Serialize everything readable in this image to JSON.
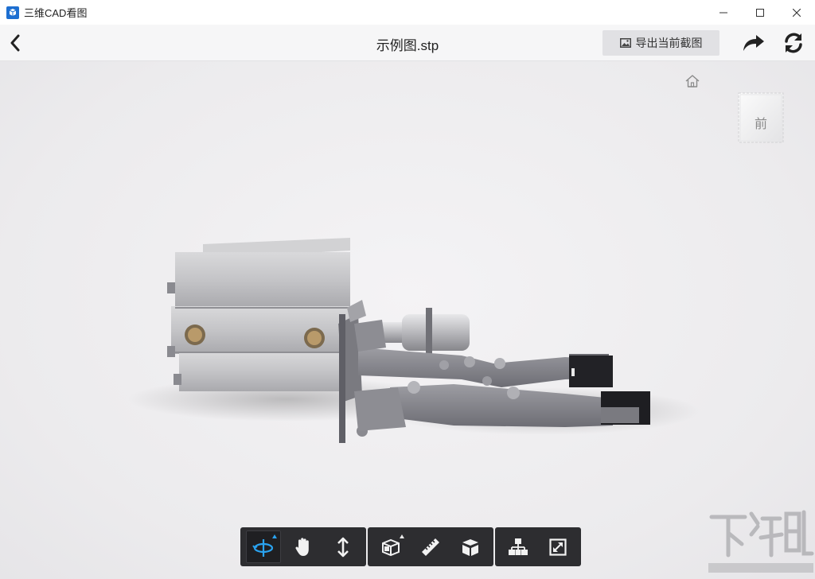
{
  "window": {
    "title": "三维CAD看图",
    "controls": [
      "minimize-icon",
      "maximize-icon",
      "close-icon"
    ]
  },
  "header": {
    "back_icon": "chevron-left-icon",
    "file_name": "示例图.stp",
    "export_label": "导出当前截图",
    "export_icon": "image-icon",
    "share_icon": "share-arrow-icon",
    "refresh_icon": "refresh-icon"
  },
  "viewport": {
    "home_icon": "home-icon",
    "view_cube_face": "前"
  },
  "toolbar": {
    "groups": [
      [
        {
          "icon": "rotate-orbit-icon",
          "active": true,
          "has_menu": true
        },
        {
          "icon": "pan-hand-icon",
          "active": false
        },
        {
          "icon": "zoom-vertical-icon",
          "active": false
        }
      ],
      [
        {
          "icon": "section-box-icon",
          "active": false,
          "has_menu": true
        },
        {
          "icon": "measure-ruler-icon",
          "active": false
        },
        {
          "icon": "explode-cube-icon",
          "active": false
        }
      ],
      [
        {
          "icon": "model-tree-icon",
          "active": false
        },
        {
          "icon": "fullscreen-icon",
          "active": false
        }
      ]
    ]
  },
  "colors": {
    "titlebar": "#ffffff",
    "header": "#f6f6f7",
    "viewport": "#efeef0",
    "toolbar": "#2d2d30",
    "accent": "#2aa3f0"
  }
}
